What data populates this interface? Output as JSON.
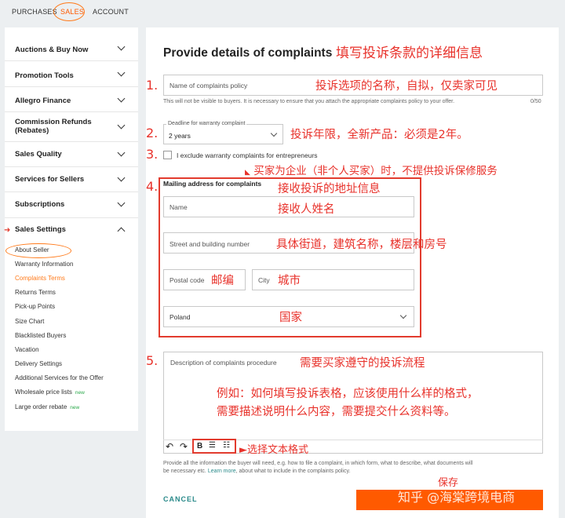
{
  "topnav": {
    "purchases": "PURCHASES",
    "sales": "SALES",
    "account": "ACCOUNT"
  },
  "sidebar": {
    "items": [
      {
        "label": "Auctions & Buy Now"
      },
      {
        "label": "Promotion Tools"
      },
      {
        "label": "Allegro Finance"
      },
      {
        "label": "Commission Refunds (Rebates)"
      },
      {
        "label": "Sales Quality"
      },
      {
        "label": "Services for Sellers"
      },
      {
        "label": "Subscriptions"
      },
      {
        "label": "Sales Settings"
      }
    ],
    "sub_items": [
      "About Seller",
      "Warranty Information",
      "Complaints Terms",
      "Returns Terms",
      "Pick-up Points",
      "Size Chart",
      "Blacklisted Buyers",
      "Vacation",
      "Delivery Settings",
      "Additional Services for the Offer",
      "Wholesale price lists",
      "Large order rebate"
    ],
    "new_badge": "new"
  },
  "form": {
    "title": "Provide details of complaints",
    "policy_name_placeholder": "Name of complaints policy",
    "policy_help": "This will not be visible to buyers. It is necessary to ensure that you attach the appropriate complaints policy to your offer.",
    "policy_counter": "0/50",
    "deadline_label": "Deadline for warranty complaint",
    "deadline_value": "2 years",
    "exclude_label": "I exclude warranty complaints for entrepreneurs",
    "address_heading": "Mailing address for complaints",
    "name_placeholder": "Name",
    "street_placeholder": "Street and building number",
    "postal_placeholder": "Postal code",
    "city_placeholder": "City",
    "country_value": "Poland",
    "description_placeholder": "Description of complaints procedure",
    "toolbar": {
      "undo": "↶",
      "redo": "↷",
      "bold": "B",
      "bullets": "☰",
      "numbered": "☷"
    },
    "desc_help_1": "Provide all the information the buyer will need, e.g. how to file a complaint, in which form, what to describe, what documents will",
    "desc_help_2": "be necessary etc.",
    "learn_more": "Learn more",
    "desc_help_3": ", about what to include in the complaints policy.",
    "cancel": "CANCEL"
  },
  "annotations": {
    "title": "填写投诉条款的详细信息",
    "n1": "1.",
    "n2": "2.",
    "n3": "3.",
    "n4": "4.",
    "n5": "5.",
    "a1": "投诉选项的名称，自拟，仅卖家可见",
    "a2": "投诉年限，全新产品：必须是2年。",
    "a3": "买家为企业（非个人买家）时，不提供投诉保修服务",
    "a4": "接收投诉的地址信息",
    "a_name": "接收人姓名",
    "a_street": "具体街道，建筑名称，楼层和房号",
    "a_postal": "邮编",
    "a_city": "城市",
    "a_country": "国家",
    "a5": "需要买家遵守的投诉流程",
    "example_1": "例如：如何填写投诉表格，应该使用什么样的格式，",
    "example_2": "需要描述说明什么内容，需要提交什么资料等。",
    "toolbar_note": "►选择文本格式",
    "save": "保存",
    "watermark": "知乎 @海棠跨境电商"
  },
  "colors": {
    "accent": "#ff5a00",
    "annotation": "#e8322b",
    "teal": "#2a8a8a"
  }
}
